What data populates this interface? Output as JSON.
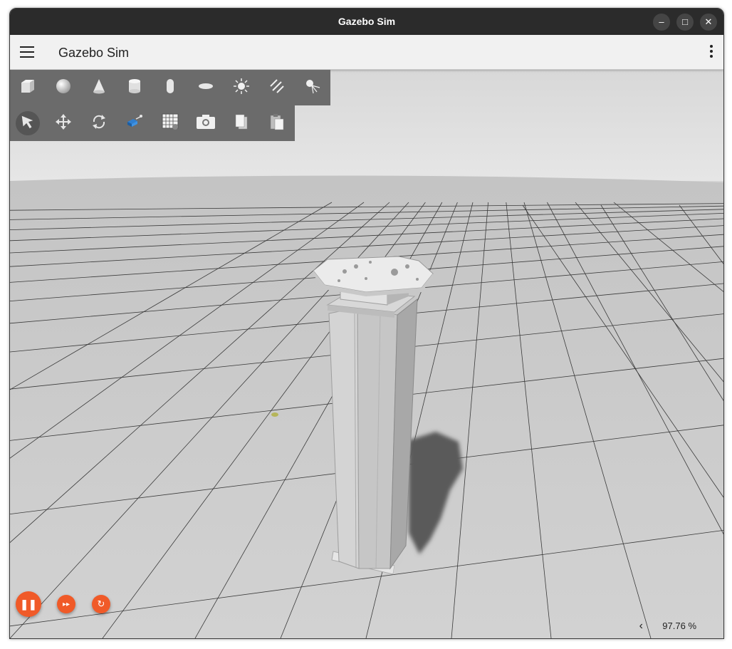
{
  "window": {
    "title": "Gazebo Sim",
    "controls": {
      "minimize": "–",
      "maximize": "□",
      "close": "✕"
    }
  },
  "appbar": {
    "title": "Gazebo Sim",
    "menu_icon": "hamburger-menu-icon",
    "more_icon": "kebab-menu-icon"
  },
  "toolbar_shapes": [
    {
      "name": "box",
      "icon": "box-icon"
    },
    {
      "name": "sphere",
      "icon": "sphere-icon"
    },
    {
      "name": "cone",
      "icon": "cone-icon"
    },
    {
      "name": "cylinder",
      "icon": "cylinder-icon"
    },
    {
      "name": "capsule",
      "icon": "capsule-icon"
    },
    {
      "name": "ellipsoid",
      "icon": "ellipsoid-icon"
    },
    {
      "name": "point-light",
      "icon": "point-light-icon"
    },
    {
      "name": "directional-light",
      "icon": "directional-light-icon"
    },
    {
      "name": "spot-light",
      "icon": "spot-light-icon"
    }
  ],
  "toolbar_transform": [
    {
      "name": "select",
      "icon": "select-arrow-icon",
      "selected": true
    },
    {
      "name": "translate",
      "icon": "translate-icon"
    },
    {
      "name": "rotate",
      "icon": "rotate-icon"
    },
    {
      "name": "view-angle",
      "icon": "view-angle-icon"
    },
    {
      "name": "grid-config",
      "icon": "grid-icon"
    },
    {
      "name": "screenshot",
      "icon": "camera-icon"
    },
    {
      "name": "copy",
      "icon": "copy-icon"
    },
    {
      "name": "paste",
      "icon": "paste-icon"
    }
  ],
  "playback": {
    "pause": "❚❚",
    "step": "▸▸",
    "reset": "↻"
  },
  "status": {
    "real_time_factor": "97.76 %",
    "collapse_icon": "‹"
  },
  "colors": {
    "accent": "#f05a28",
    "titlebar": "#2b2b2b",
    "toolbar": "#6b6b6b",
    "ground": "#cdcdcd",
    "sky": "#dcdcdc"
  }
}
